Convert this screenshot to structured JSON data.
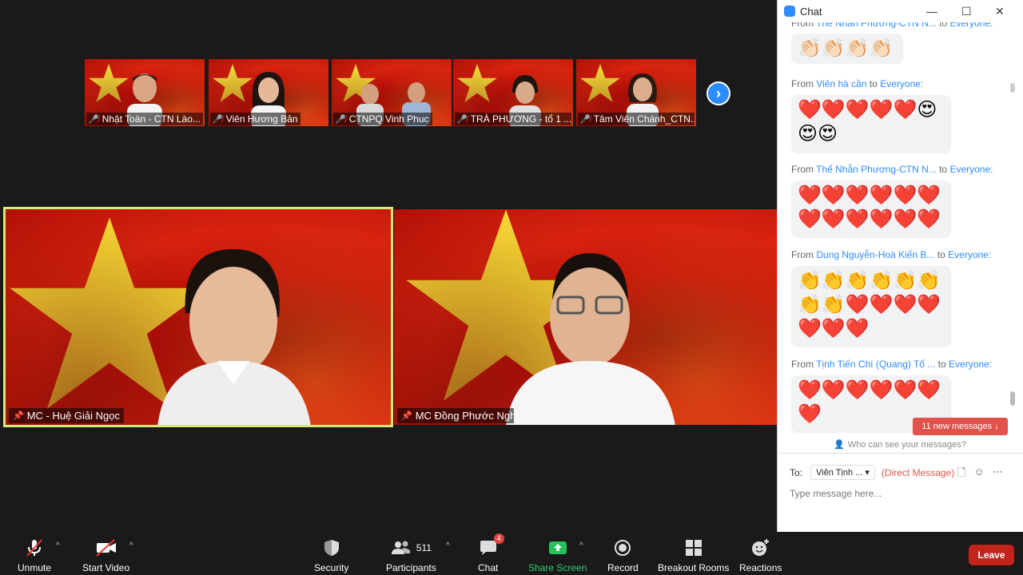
{
  "thumbnails": [
    {
      "name": "Nhật Toàn - CTN Lào..."
    },
    {
      "name": "Viên Hương Bản"
    },
    {
      "name": "CTNPQ Vinh Phuc"
    },
    {
      "name": "TRÀ PHƯƠNG - tổ 1 ..."
    },
    {
      "name": "Tâm Viên Chánh_CTN..."
    }
  ],
  "main": [
    {
      "name": "MC - Huệ Giải Ngọc"
    },
    {
      "name": "MC Đồng Phước Nghĩa"
    }
  ],
  "toolbar": {
    "unmute": "Unmute",
    "start_video": "Start Video",
    "security": "Security",
    "participants": "Participants",
    "participant_count": "511",
    "chat": "Chat",
    "chat_badge": "4",
    "share_screen": "Share Screen",
    "record": "Record",
    "breakout_rooms": "Breakout Rooms",
    "reactions": "Reactions",
    "leave": "Leave"
  },
  "chat": {
    "title": "Chat",
    "messages": [
      {
        "from_label": "From",
        "sender": "Thể Nhẫn Phương-CTN N...",
        "to_label": "to",
        "recipient": "Everyone:",
        "content": "👏🏻👏🏻👏🏻👏🏻"
      },
      {
        "from_label": "From",
        "sender": "Viên hà cần",
        "to_label": "to",
        "recipient": "Everyone:",
        "content": "❤️❤️❤️❤️❤️😍😍😍"
      },
      {
        "from_label": "From",
        "sender": "Thể Nhẫn Phương-CTN N...",
        "to_label": "to",
        "recipient": "Everyone:",
        "content": "❤️❤️❤️❤️❤️❤️❤️❤️❤️❤️❤️❤️"
      },
      {
        "from_label": "From",
        "sender": "Dung Nguyễn-Hoà Kiến B...",
        "to_label": "to",
        "recipient": "Everyone:",
        "content": "👏👏👏👏👏👏👏👏❤️❤️❤️❤️❤️❤️❤️"
      },
      {
        "from_label": "From",
        "sender": "Tịnh Tiến Chí (Quang) Tổ ...",
        "to_label": "to",
        "recipient": "Everyone:",
        "content": "❤️❤️❤️❤️❤️❤️❤️"
      }
    ],
    "new_messages": "11 new messages ↓",
    "who_can_see": "Who can see your messages?",
    "to_label": "To:",
    "to_value": "Viên Tịnh ...",
    "direct_message": "(Direct Message)",
    "placeholder": "Type message here...",
    "accent_color": "#2d8cff"
  }
}
